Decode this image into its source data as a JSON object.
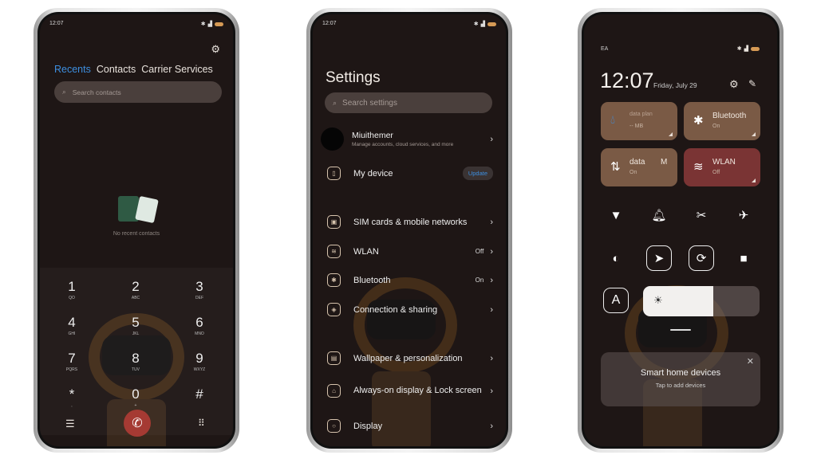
{
  "phone1": {
    "time": "12:07",
    "tabs": [
      "Recents",
      "Contacts",
      "Carrier Services"
    ],
    "search_placeholder": "Search contacts",
    "empty_text": "No recent contacts",
    "keys": [
      {
        "n": "1",
        "l": "QO"
      },
      {
        "n": "2",
        "l": "ABC"
      },
      {
        "n": "3",
        "l": "DEF"
      },
      {
        "n": "4",
        "l": "GHI"
      },
      {
        "n": "5",
        "l": "JKL"
      },
      {
        "n": "6",
        "l": "MNO"
      },
      {
        "n": "7",
        "l": "PQRS"
      },
      {
        "n": "8",
        "l": "TUV"
      },
      {
        "n": "9",
        "l": "WXYZ"
      },
      {
        "n": "*",
        "l": ","
      },
      {
        "n": "0",
        "l": "+"
      },
      {
        "n": "#",
        "l": ""
      }
    ]
  },
  "phone2": {
    "time": "12:07",
    "title": "Settings",
    "search_placeholder": "Search settings",
    "account": {
      "name": "Miuithemer",
      "sub": "Manage accounts, cloud services, and more"
    },
    "my_device": "My device",
    "update": "Update",
    "items": [
      {
        "label": "SIM cards & mobile networks",
        "value": ""
      },
      {
        "label": "WLAN",
        "value": "Off"
      },
      {
        "label": "Bluetooth",
        "value": "On"
      },
      {
        "label": "Connection & sharing",
        "value": ""
      },
      {
        "label": "Wallpaper & personalization",
        "value": ""
      },
      {
        "label": "Always-on display & Lock screen",
        "value": ""
      },
      {
        "label": "Display",
        "value": ""
      }
    ]
  },
  "phone3": {
    "carrier": "EA",
    "time": "12:07",
    "date": "Friday, July 29",
    "tiles": [
      {
        "title": "data plan",
        "sub": "-- MB",
        "icon": "water-drop-icon"
      },
      {
        "title": "Bluetooth",
        "sub": "On",
        "icon": "bluetooth-icon"
      },
      {
        "title": "data",
        "extra": "M",
        "sub": "On",
        "icon": "mobile-data-icon"
      },
      {
        "title": "WLAN",
        "sub": "Off",
        "icon": "wifi-icon"
      }
    ],
    "brightness_percent": 60,
    "smart_home": {
      "title": "Smart home devices",
      "sub": "Tap to add devices"
    }
  },
  "colors": {
    "accent": "#3d8fe0",
    "tile": "#7a5a45",
    "tile_wlan": "#7a3434",
    "call": "#a53a33",
    "bg": "#1e1615"
  }
}
